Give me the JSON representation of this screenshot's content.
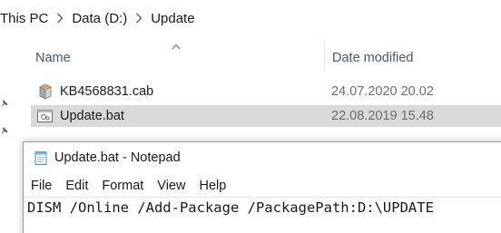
{
  "explorer": {
    "breadcrumb": [
      "This PC",
      "Data (D:)",
      "Update"
    ],
    "columns": {
      "name": "Name",
      "date_modified": "Date modified"
    },
    "files": [
      {
        "name": "KB4568831.cab",
        "date": "24.07.2020 20.02",
        "icon": "cabinet-file-icon",
        "selected": false
      },
      {
        "name": "Update.bat",
        "date": "22.08.2019 15.48",
        "icon": "batch-file-icon",
        "selected": true
      }
    ]
  },
  "notepad": {
    "title": "Update.bat - Notepad",
    "icon": "notepad-icon",
    "menu": [
      "File",
      "Edit",
      "Format",
      "View",
      "Help"
    ],
    "content": "DISM /Online /Add-Package /PackagePath:D:\\UPDATE"
  },
  "colors": {
    "selection": "#d9d9d9",
    "header_text": "#4a5a6a",
    "date_text": "#6d6d6d"
  }
}
